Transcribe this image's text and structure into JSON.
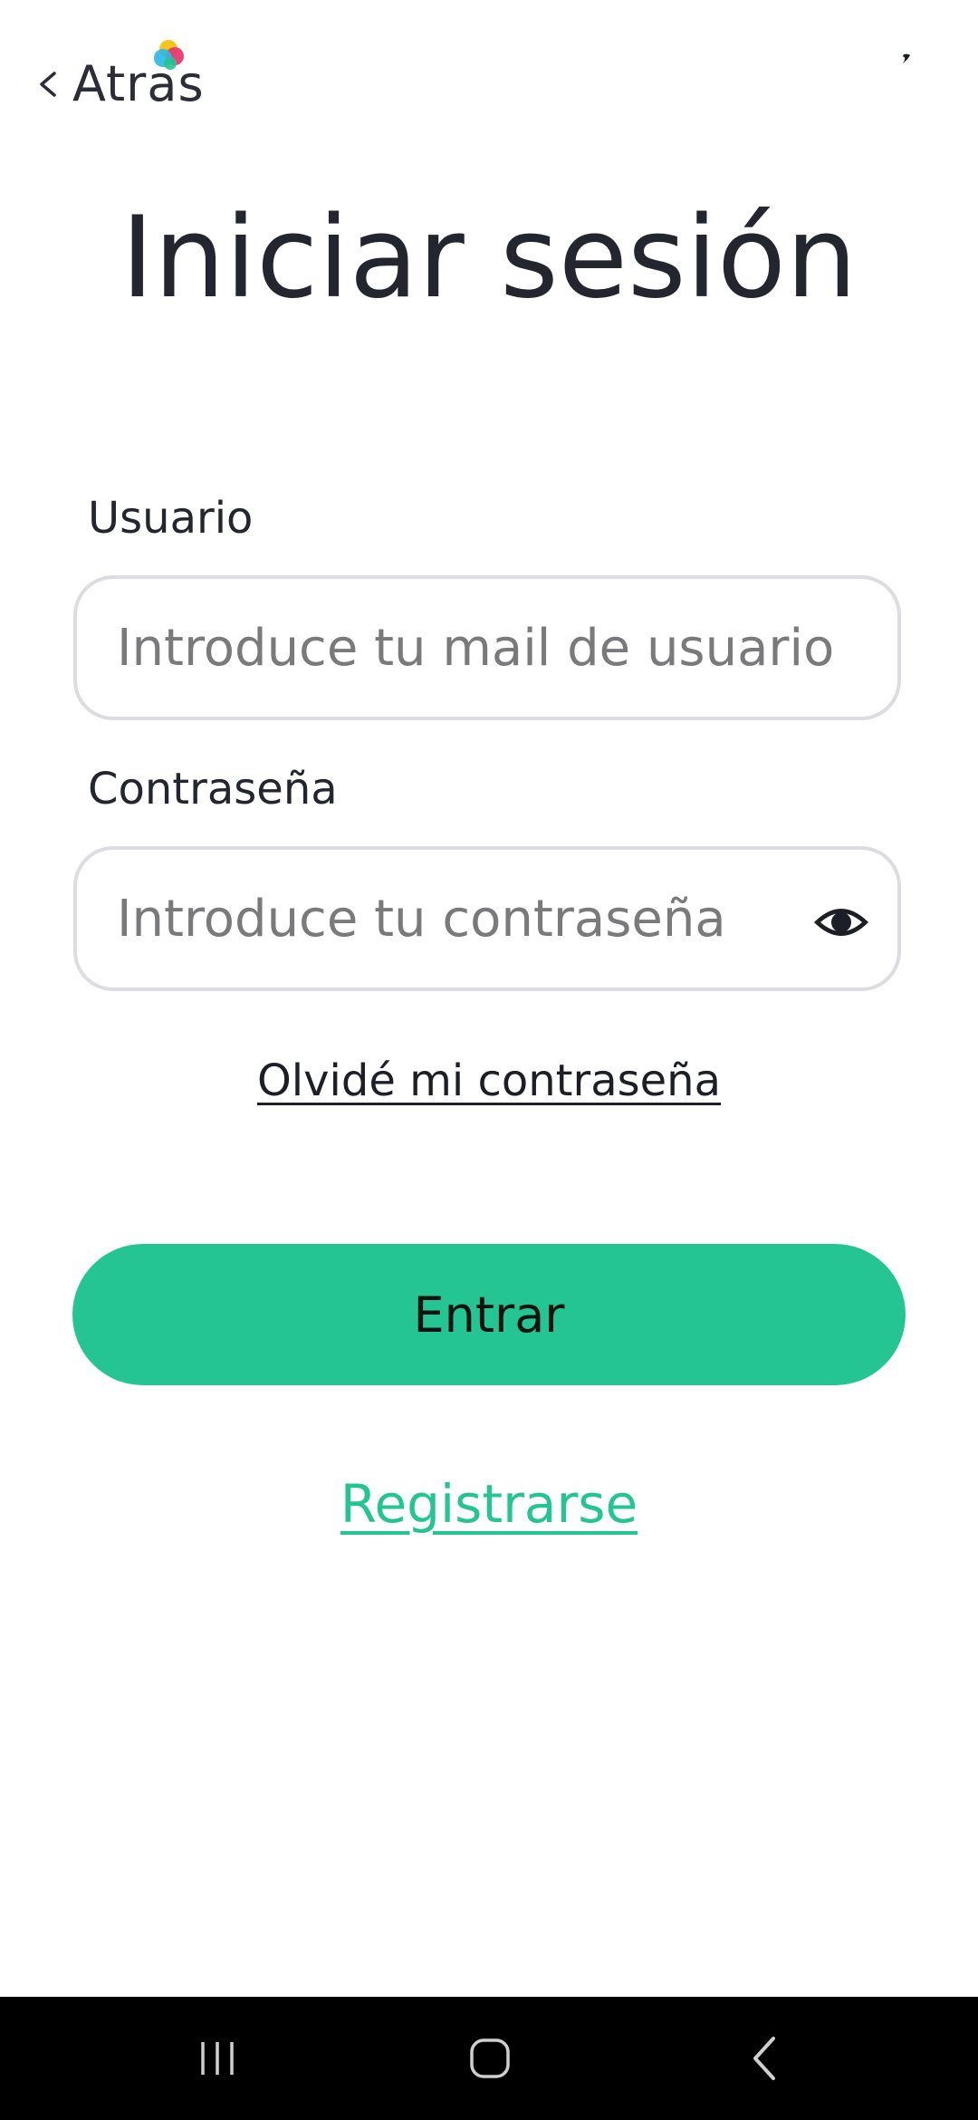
{
  "header": {
    "back_label": "Atras",
    "back_icon": "chevron-left-icon",
    "logo_colors": [
      "#f5c518",
      "#e8336f",
      "#2bb7e8",
      "#24c592"
    ]
  },
  "title": "Iniciar sesión",
  "user_field": {
    "label": "Usuario",
    "placeholder": "Introduce tu mail de usuario",
    "value": ""
  },
  "password_field": {
    "label": "Contraseña",
    "placeholder": "Introduce tu contraseña",
    "value": "",
    "toggle_icon": "eye-icon"
  },
  "forgot_password": "Olvidé mi contraseña",
  "submit_label": "Entrar",
  "register_label": "Registrarse",
  "colors": {
    "accent": "#24c592",
    "text": "#23262e",
    "input_border": "#dcdce2",
    "nav_background": "#000000"
  },
  "system_nav": {
    "recents_icon": "recents-icon",
    "home_icon": "home-icon",
    "back_icon": "back-icon"
  }
}
